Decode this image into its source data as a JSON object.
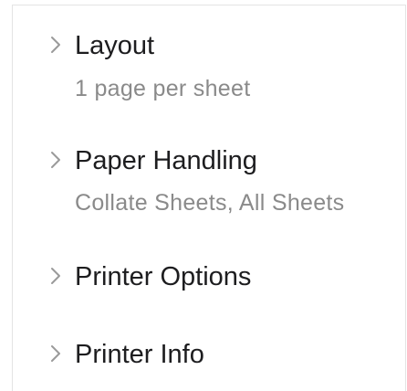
{
  "sections": [
    {
      "title": "Layout",
      "subtitle": "1 page per sheet",
      "icon": "chevron-right-icon",
      "expanded": false
    },
    {
      "title": "Paper Handling",
      "subtitle": "Collate Sheets, All Sheets",
      "icon": "chevron-right-icon",
      "expanded": false
    },
    {
      "title": "Printer Options",
      "subtitle": "",
      "icon": "chevron-right-icon",
      "expanded": false
    },
    {
      "title": "Printer Info",
      "subtitle": "",
      "icon": "chevron-right-icon",
      "expanded": false
    }
  ],
  "colors": {
    "title": "#1d1d1f",
    "subtitle": "#8a8a8a",
    "chevron": "#9a9a9a",
    "border": "#e4e4e4"
  }
}
